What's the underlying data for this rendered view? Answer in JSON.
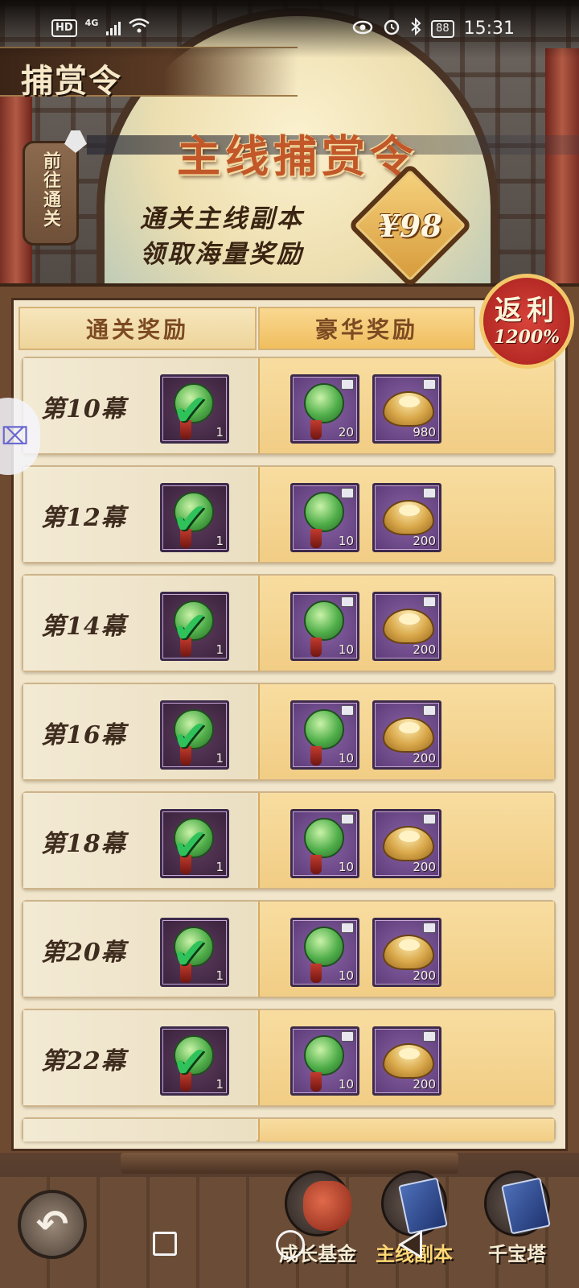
{
  "status_bar": {
    "hd": "HD",
    "network": "4G",
    "battery": "88",
    "time": "15:31",
    "icons": [
      "wifi-icon",
      "eye-icon",
      "alarm-icon",
      "bluetooth-icon",
      "battery-icon"
    ]
  },
  "banner": {
    "page_title": "捕赏令",
    "goto_label": "前往通关",
    "heading": "主线捕赏令",
    "line1": "通关主线副本",
    "line2": "领取海量奖励",
    "price": "¥98"
  },
  "tabs": {
    "basic": "通关奖励",
    "deluxe": "豪华奖励"
  },
  "rebate": {
    "title": "返利",
    "percent": "1200%"
  },
  "rewards": [
    {
      "stage": "第10幕",
      "basic_qty": "1",
      "jade_qty": "20",
      "ingot_qty": "980"
    },
    {
      "stage": "第12幕",
      "basic_qty": "1",
      "jade_qty": "10",
      "ingot_qty": "200"
    },
    {
      "stage": "第14幕",
      "basic_qty": "1",
      "jade_qty": "10",
      "ingot_qty": "200"
    },
    {
      "stage": "第16幕",
      "basic_qty": "1",
      "jade_qty": "10",
      "ingot_qty": "200"
    },
    {
      "stage": "第18幕",
      "basic_qty": "1",
      "jade_qty": "10",
      "ingot_qty": "200"
    },
    {
      "stage": "第20幕",
      "basic_qty": "1",
      "jade_qty": "10",
      "ingot_qty": "200"
    },
    {
      "stage": "第22幕",
      "basic_qty": "1",
      "jade_qty": "10",
      "ingot_qty": "200"
    }
  ],
  "bottom_nav": {
    "back_icon": "back-arrow-icon",
    "items": [
      {
        "label": "成长基金",
        "icon": "money-bag-icon",
        "active": false
      },
      {
        "label": "主线副本",
        "icon": "book-icon",
        "active": true
      },
      {
        "label": "千宝塔",
        "icon": "book-icon",
        "active": false
      }
    ]
  },
  "colors": {
    "panel_bg": "#f1e6cc",
    "deluxe_bg": "#f1cd85",
    "check": "#2fc25a",
    "rebate_red": "#c2302a"
  }
}
